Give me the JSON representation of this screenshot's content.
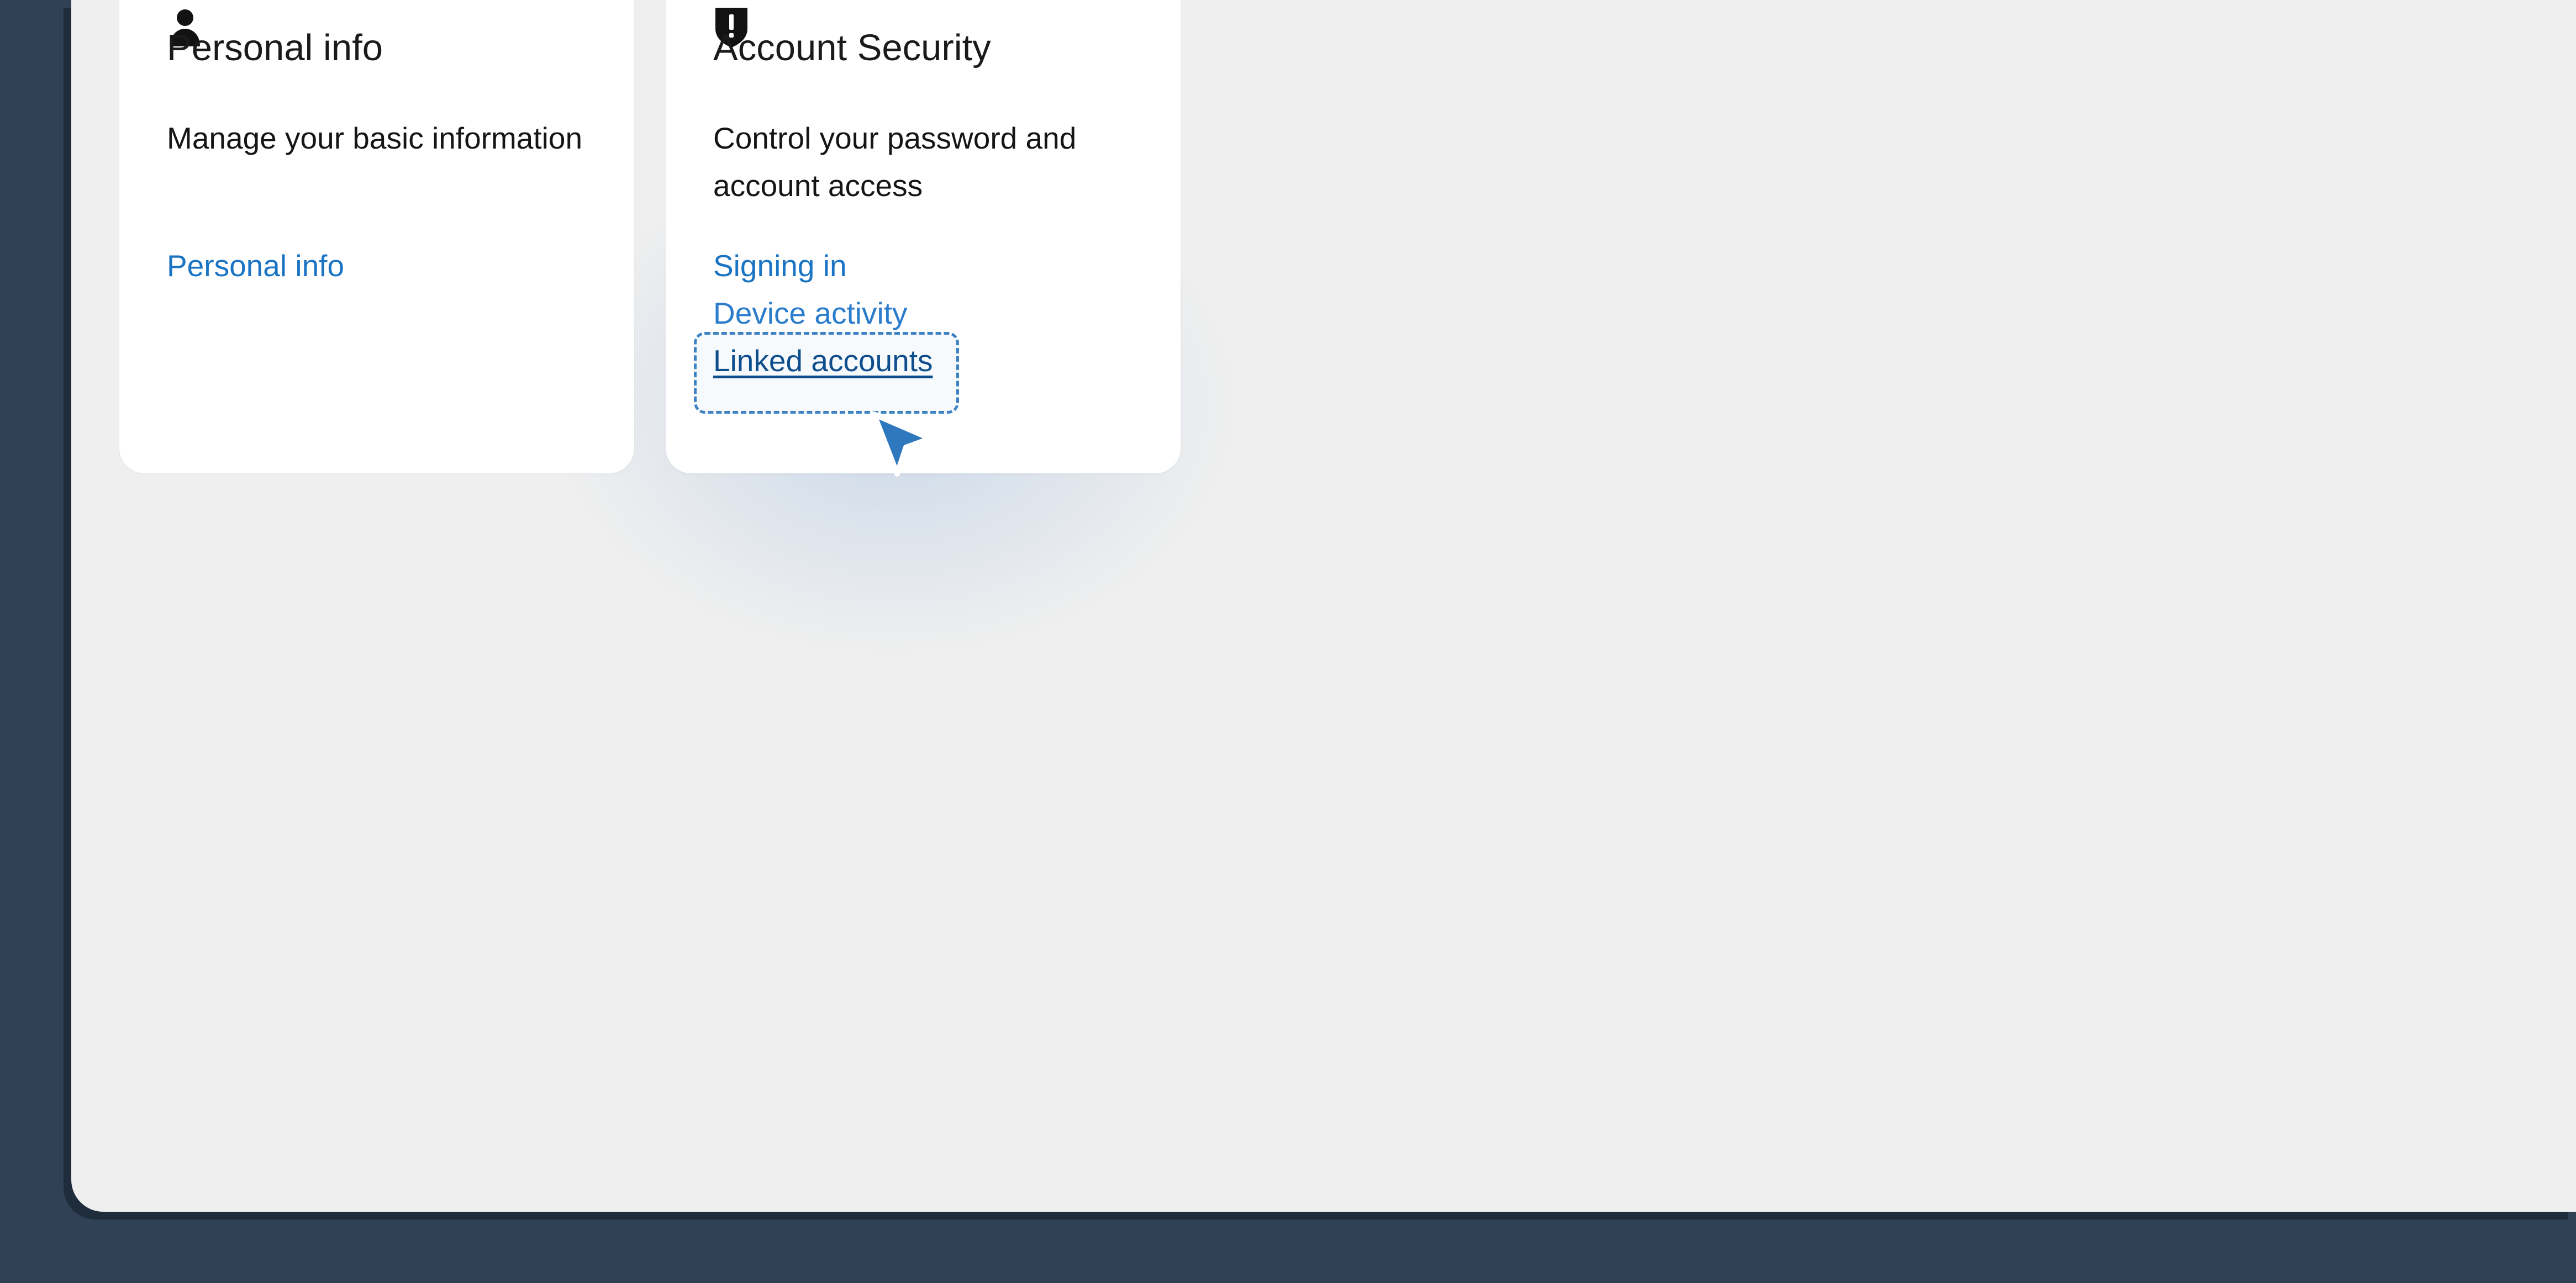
{
  "cards": [
    {
      "icon": "person-icon",
      "title": "Personal info",
      "description": "Manage your basic information",
      "links": [
        "Personal info"
      ]
    },
    {
      "icon": "shield-alert-icon",
      "title": "Account Security",
      "description": "Control your password and account access",
      "links": [
        "Signing in",
        "Device activity",
        "Linked accounts"
      ]
    }
  ],
  "colors": {
    "background": "#304156",
    "panel": "#efefef",
    "card": "#ffffff",
    "link": "#1a73c3",
    "focus_ring": "#3d82c4",
    "cursor": "#2f78bd"
  },
  "cursor": {
    "icon": "pointer-cursor-icon"
  }
}
